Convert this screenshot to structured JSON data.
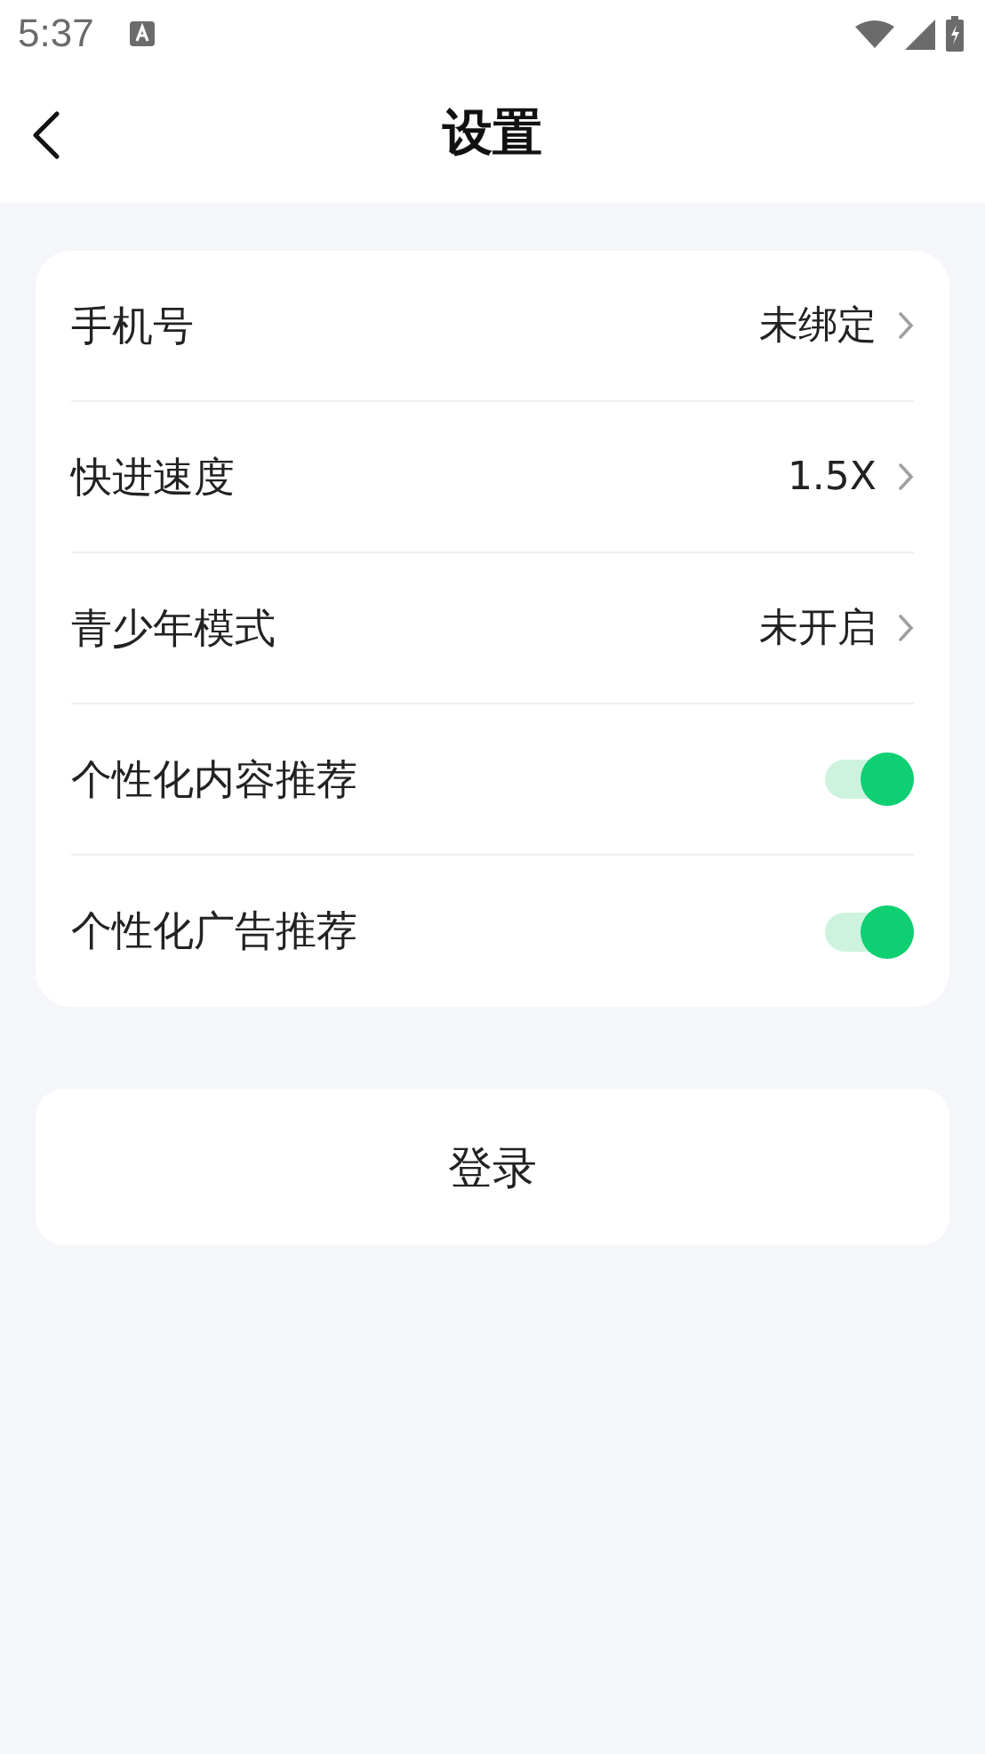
{
  "status_bar": {
    "time": "5:37"
  },
  "header": {
    "title": "设置"
  },
  "settings": [
    {
      "kind": "link",
      "label": "手机号",
      "value": "未绑定"
    },
    {
      "kind": "link",
      "label": "快进速度",
      "value": "1.5X"
    },
    {
      "kind": "link",
      "label": "青少年模式",
      "value": "未开启"
    },
    {
      "kind": "toggle",
      "label": "个性化内容推荐",
      "on": true
    },
    {
      "kind": "toggle",
      "label": "个性化广告推荐",
      "on": true
    }
  ],
  "login_button": "登录"
}
